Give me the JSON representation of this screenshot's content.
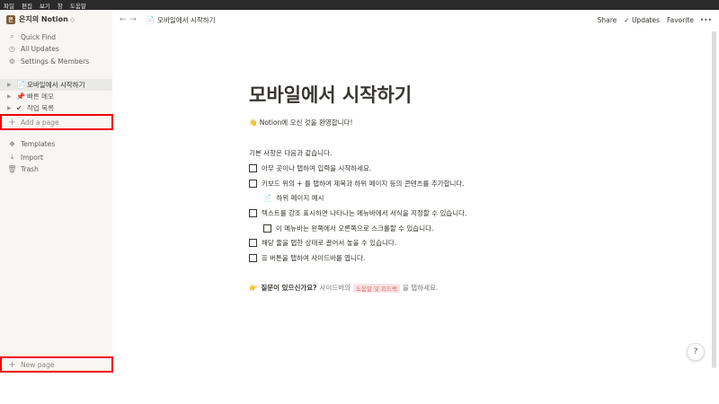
{
  "menubar": [
    "파일",
    "편집",
    "보기",
    "창",
    "도움말"
  ],
  "workspace": {
    "name": "은지의 Notion",
    "chevron": "◇"
  },
  "sidebar": {
    "quick": [
      {
        "label": "Quick Find",
        "icon": "search-icon"
      },
      {
        "label": "All Updates",
        "icon": "clock-icon"
      },
      {
        "label": "Settings & Members",
        "icon": "gear-icon"
      }
    ],
    "pages": [
      {
        "label": "모바일에서 시작하기",
        "emoji": "📄"
      },
      {
        "label": "빠른 메모",
        "emoji": "📌"
      },
      {
        "label": "작업 목록",
        "emoji": "✔"
      }
    ],
    "add_page": "Add a page",
    "bottom": [
      {
        "label": "Templates",
        "icon": "templates-icon"
      },
      {
        "label": "Import",
        "icon": "import-icon"
      },
      {
        "label": "Trash",
        "icon": "trash-icon"
      }
    ],
    "new_page": "New page"
  },
  "topbar": {
    "breadcrumb": "모바일에서 시작하기",
    "share": "Share",
    "updates": "Updates",
    "favorite": "Favorite"
  },
  "page": {
    "title": "모바일에서 시작하기",
    "welcome": "👋 Notion에 오신 것을 환영합니다!",
    "basics": "기본 사항은 다음과 같습니다.",
    "todos": [
      "아무 곳이나 탭하여 입력을 시작하세요.",
      "키보드 위의 + 를 탭하여 제목과 하위 페이지 등의 콘텐츠를 추가합니다.",
      "하위 페이지 예시",
      "텍스트를 강조 표시하면 나타나는 메뉴바에서 서식을 지정할 수 있습니다.",
      "이 메뉴바는 왼쪽에서 오른쪽으로 스크롤할 수 있습니다.",
      "해당 줄을 탭한 상태로 끌어서 놓을 수 있습니다.",
      "☰ 버튼을 탭하여 사이드바를 엽니다."
    ],
    "question_bold": "질문이 있으신가요?",
    "question_pre": "사이드바의",
    "question_tag": "도움말 및 피드백",
    "question_post": "을 탭하세요."
  },
  "help": "?"
}
